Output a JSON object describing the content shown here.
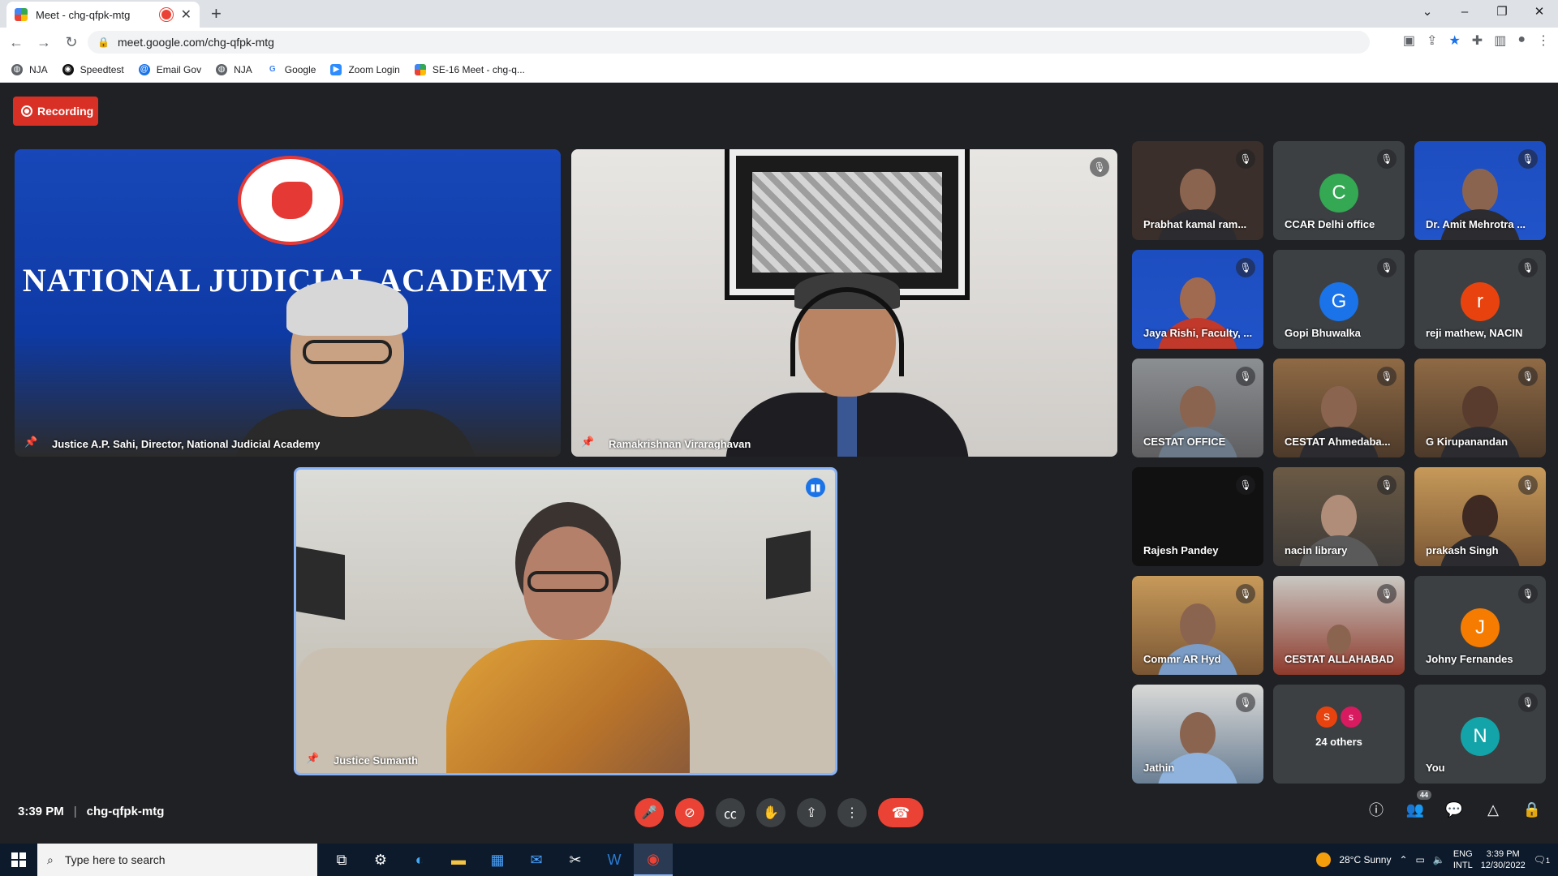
{
  "browser": {
    "tab_title": "Meet - chg-qfpk-mtg",
    "new_tab": "+",
    "url": "meet.google.com/chg-qfpk-mtg",
    "window_controls": [
      "⌄",
      "–",
      "❐",
      "✕"
    ],
    "bookmarks": [
      {
        "label": "NJA",
        "icon": "globe-icon"
      },
      {
        "label": "Speedtest",
        "icon": "speedtest-icon"
      },
      {
        "label": "Email Gov",
        "icon": "email-icon"
      },
      {
        "label": "NJA",
        "icon": "globe-icon"
      },
      {
        "label": "Google",
        "icon": "google-icon"
      },
      {
        "label": "Zoom Login",
        "icon": "zoom-icon"
      },
      {
        "label": "SE-16 Meet - chg-q...",
        "icon": "meet-icon"
      }
    ]
  },
  "meet": {
    "recording_label": "Recording",
    "main_tiles": [
      {
        "name": "Justice A.P. Sahi, Director, National Judicial Academy",
        "banner": "NATIONAL JUDICIAL ACADEMY"
      },
      {
        "name": "Ramakrishnan Viraraghavan"
      },
      {
        "name": "Justice Sumanth"
      }
    ],
    "small_tiles": [
      {
        "name": "Prabhat kamal ram...",
        "type": "video"
      },
      {
        "name": "CCAR Delhi office",
        "type": "avatar",
        "initial": "C",
        "color": "#34a853"
      },
      {
        "name": "Dr. Amit Mehrotra ...",
        "type": "video"
      },
      {
        "name": "Jaya Rishi, Faculty, ...",
        "type": "video"
      },
      {
        "name": "Gopi Bhuwalka",
        "type": "avatar",
        "initial": "G",
        "color": "#1a73e8"
      },
      {
        "name": "reji mathew, NACIN",
        "type": "avatar",
        "initial": "r",
        "color": "#e8430e"
      },
      {
        "name": "CESTAT OFFICE",
        "type": "video"
      },
      {
        "name": "CESTAT Ahmedaba...",
        "type": "video"
      },
      {
        "name": "G Kirupanandan",
        "type": "video"
      },
      {
        "name": "Rajesh Pandey",
        "type": "video"
      },
      {
        "name": "nacin library",
        "type": "video"
      },
      {
        "name": "prakash Singh",
        "type": "video"
      },
      {
        "name": "Commr AR Hyd",
        "type": "video"
      },
      {
        "name": "CESTAT ALLAHABAD",
        "type": "video"
      },
      {
        "name": "Johny Fernandes",
        "type": "avatar",
        "initial": "J",
        "color": "#f57c00"
      },
      {
        "name": "Jathin",
        "type": "video"
      },
      {
        "name": "24 others",
        "type": "others",
        "initials": [
          "S",
          "s"
        ],
        "colors": [
          "#e8430e",
          "#d81b60"
        ]
      },
      {
        "name": "You",
        "type": "avatar",
        "initial": "N",
        "color": "#12a4a8"
      }
    ],
    "bottom": {
      "time": "3:39 PM",
      "separator": "|",
      "meeting_code": "chg-qfpk-mtg",
      "participant_count": "44"
    }
  },
  "taskbar": {
    "search_placeholder": "Type here to search",
    "weather": "28°C  Sunny",
    "lang_line1": "ENG",
    "lang_line2": "INTL",
    "clock_time": "3:39 PM",
    "clock_date": "12/30/2022",
    "notifications": "1"
  }
}
